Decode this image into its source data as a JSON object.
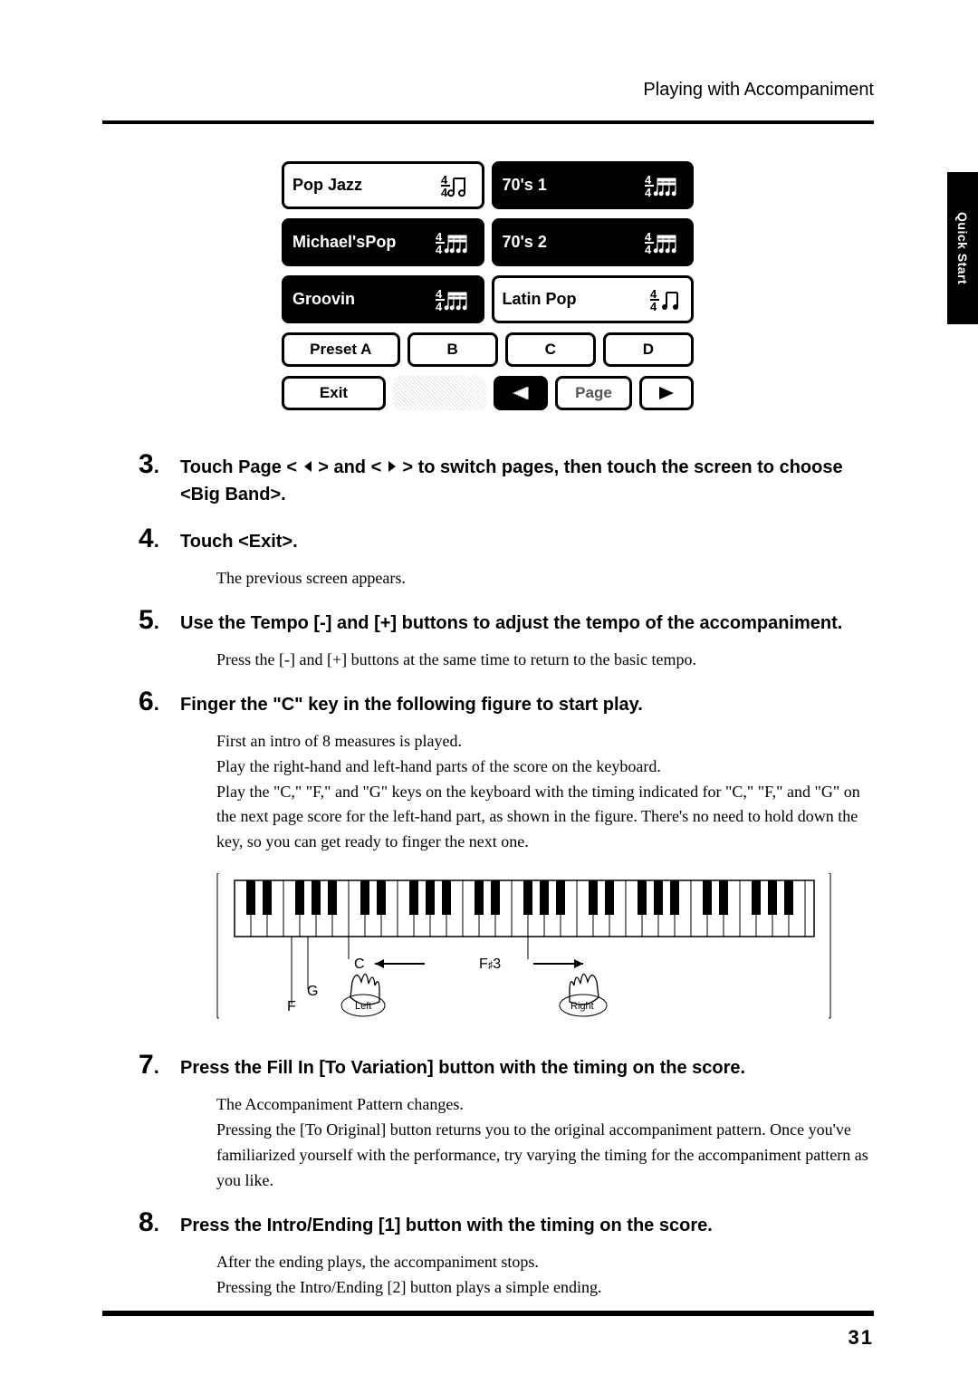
{
  "header": "Playing with Accompaniment",
  "side_tab": "Quick Start",
  "lcd": {
    "row1": [
      {
        "label": "Pop Jazz",
        "dark": false,
        "beat": "4/4-a"
      },
      {
        "label": "70's 1",
        "dark": true,
        "beat": "4/4-b"
      }
    ],
    "row2": [
      {
        "label": "Michael'sPop",
        "dark": true,
        "beat": "4/4-b"
      },
      {
        "label": "70's 2",
        "dark": true,
        "beat": "4/4-b"
      }
    ],
    "row3": [
      {
        "label": "Groovin",
        "dark": true,
        "beat": "4/4-b"
      },
      {
        "label": "Latin Pop",
        "dark": false,
        "beat": "4/4-c"
      }
    ],
    "presets": [
      "Preset A",
      "B",
      "C",
      "D"
    ],
    "exit": "Exit",
    "page": "Page"
  },
  "steps": [
    {
      "num": "3",
      "title_pre": "Touch Page < ",
      "title_mid": " > and < ",
      "title_post": " > to switch pages, then touch the screen to choose <Big Band>."
    },
    {
      "num": "4",
      "title": "Touch <Exit>.",
      "body": [
        "The previous screen appears."
      ]
    },
    {
      "num": "5",
      "title": "Use the Tempo [-] and [+] buttons to adjust the tempo of the accompaniment.",
      "body": [
        "Press the [-] and [+] buttons at the same time to return to the basic tempo."
      ]
    },
    {
      "num": "6",
      "title": "Finger the \"C\" key in the following figure to start play.",
      "body": [
        "First an intro of 8 measures is played.",
        "Play the right-hand and left-hand parts of the score on the keyboard.",
        "Play the \"C,\" \"F,\" and \"G\" keys on the keyboard with the timing indicated for \"C,\" \"F,\" and \"G\" on the next page score for the left-hand part, as shown in the figure. There's no need to hold down the key, so you can get ready to finger the next one."
      ],
      "figure_labels": {
        "c": "C",
        "g": "G",
        "f": "F",
        "fs3": "F#3",
        "left": "Left",
        "right": "Right"
      }
    },
    {
      "num": "7",
      "title": "Press the Fill In [To Variation] button with the timing on the score.",
      "body": [
        "The Accompaniment Pattern changes.",
        "Pressing the [To Original] button returns you to the original accompaniment pattern. Once you've familiarized yourself with the performance, try varying the timing for the accompaniment pattern as you like."
      ]
    },
    {
      "num": "8",
      "title": "Press the Intro/Ending [1] button with the timing on the score.",
      "body": [
        "After the ending plays, the accompaniment stops.",
        "Pressing the Intro/Ending [2] button plays a simple ending."
      ]
    }
  ],
  "page_number": "31"
}
